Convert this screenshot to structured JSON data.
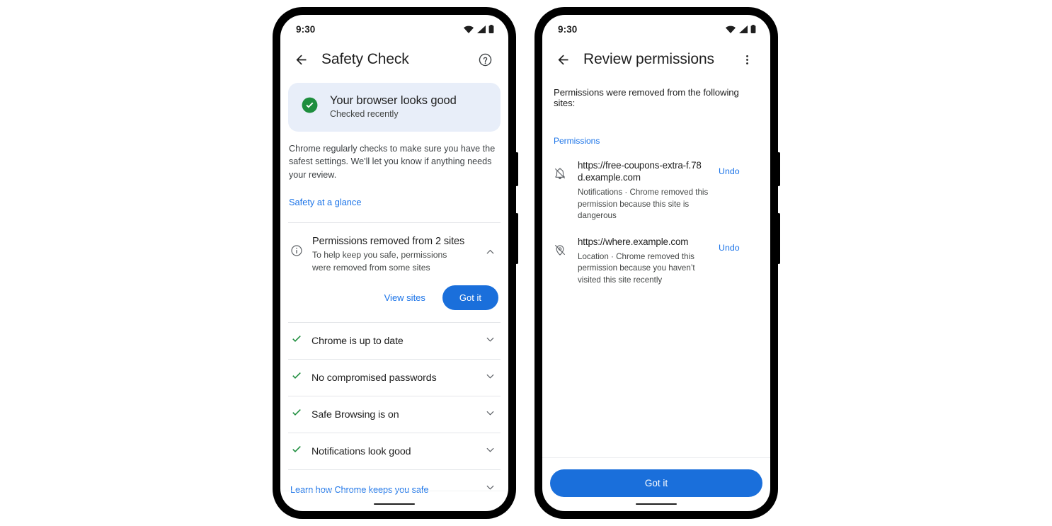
{
  "left_phone": {
    "status_bar": {
      "time": "9:30",
      "icons": [
        "wifi-icon",
        "signal-icon",
        "battery-icon"
      ]
    },
    "app_bar": {
      "back_label": "←",
      "title": "Safety Check",
      "action_icon": "help-circle-icon"
    },
    "status_card": {
      "icon": "check-circle-icon",
      "title": "Your browser looks good",
      "subtitle": "Checked recently",
      "bg_color": "#e8eef9",
      "icon_color": "#1e8e3e"
    },
    "description": "Chrome regularly checks to make sure you have the safest settings. We'll let you know if anything needs your review.",
    "glance_link": "Safety at a glance",
    "permissions_item": {
      "icon": "info-circle-icon",
      "title": "Permissions removed from 2 sites",
      "subtitle": "To help keep you safe, permissions were removed from some sites",
      "chevron": "chevron-up-icon",
      "secondary_button": "View sites",
      "primary_button": "Got it"
    },
    "check_items": [
      {
        "icon": "check-icon",
        "label": "Chrome is up to date",
        "chevron": "chevron-down-icon"
      },
      {
        "icon": "check-icon",
        "label": "No compromised passwords",
        "chevron": "chevron-down-icon"
      },
      {
        "icon": "check-icon",
        "label": "Safe Browsing is on",
        "chevron": "chevron-down-icon"
      },
      {
        "icon": "check-icon",
        "label": "Notifications look good",
        "chevron": "chevron-down-icon"
      }
    ],
    "learn_row": {
      "label": "Learn how Chrome keeps you safe",
      "chevron": "chevron-down-icon"
    }
  },
  "right_phone": {
    "status_bar": {
      "time": "9:30",
      "icons": [
        "wifi-icon",
        "signal-icon",
        "battery-icon"
      ]
    },
    "app_bar": {
      "back_label": "←",
      "title": "Review permissions",
      "action_icon": "more-vertical-icon"
    },
    "intro": "Permissions were removed from the following sites:",
    "section_label": "Permissions",
    "sites": [
      {
        "icon": "notifications-off-icon",
        "url": "https://free-coupons-extra-f.78d.example.com",
        "description": "Notifications · Chrome removed this permission because this site is dangerous",
        "undo_label": "Undo"
      },
      {
        "icon": "location-off-icon",
        "url": "https://where.example.com",
        "description": "Location · Chrome removed this permission because you haven’t visited this site recently",
        "undo_label": "Undo"
      }
    ],
    "footer_button": "Got it"
  },
  "theme": {
    "accent_blue": "#1a73e8",
    "button_blue": "#1a6fdb",
    "green": "#1e8e3e",
    "text_primary": "#1f1f1f",
    "text_secondary": "#444746",
    "card_bg": "#e8eef9",
    "divider": "#e4e6e9",
    "page_bg": "#ffffff",
    "frame_black": "#000000"
  }
}
